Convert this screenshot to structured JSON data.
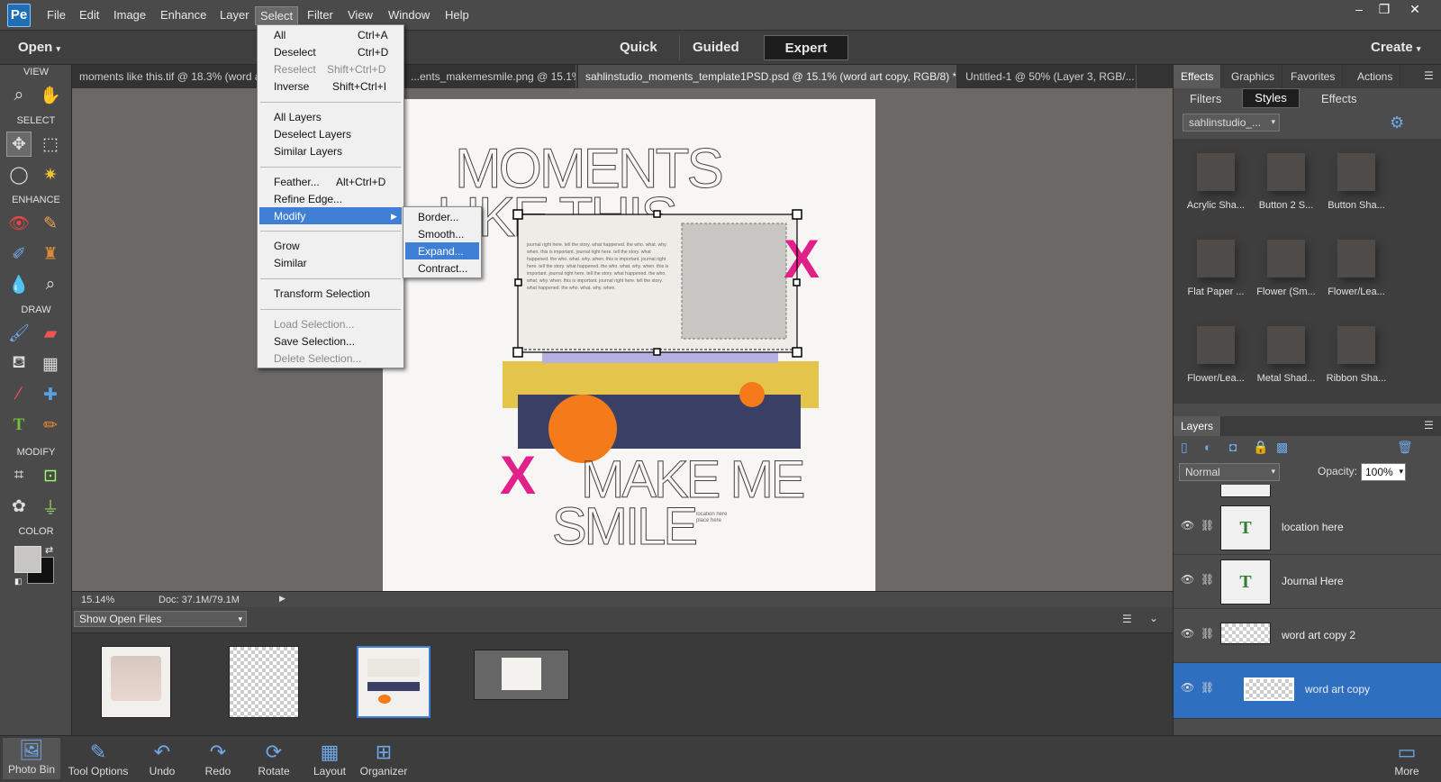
{
  "menubar": {
    "items": [
      "File",
      "Edit",
      "Image",
      "Enhance",
      "Layer",
      "Select",
      "Filter",
      "View",
      "Window",
      "Help"
    ],
    "active": "Select",
    "window_controls": [
      "–",
      "❐",
      "✕"
    ]
  },
  "modebar": {
    "open_label": "Open",
    "modes": [
      "Quick",
      "Guided",
      "Expert"
    ],
    "selected_mode": "Expert",
    "create_label": "Create"
  },
  "toolbox": {
    "sections": [
      "VIEW",
      "SELECT",
      "ENHANCE",
      "DRAW",
      "MODIFY",
      "COLOR"
    ]
  },
  "doc_tabs": [
    {
      "label": "moments like this.tif @ 18.3% (word art..."
    },
    {
      "label": "...ents_makemesmile.png @ 15.1% ..."
    },
    {
      "label": "sahlinstudio_moments_template1PSD.psd @ 15.1% (word art copy, RGB/8) *"
    },
    {
      "label": "Untitled-1 @ 50% (Layer 3, RGB/..."
    }
  ],
  "canvas": {
    "title_line1": "MOMENTS",
    "title_line2": "LIKE THIS",
    "subtitle_line1": "MAKE ME",
    "subtitle_line2": "SMILE",
    "journal_text": "journal right here. tell the story. what happened. the who. what. why. when. this is important. journal right here. tell the story. what happened. the who. what. why. when. this is important. journal right here. tell the story. what happened. the who. what. why. when. this is important. journal right here. tell the story. what happened. the who. what. why. when. this is important. journal right here. tell the story. what happened. the who. what. why. when.",
    "location_text": "location here\nplace here",
    "x_mark": "X"
  },
  "status": {
    "zoom": "15.14%",
    "doc": "Doc: 37.1M/79.1M"
  },
  "bin": {
    "dropdown": "Show Open Files"
  },
  "select_menu": {
    "items": [
      {
        "label": "All",
        "shortcut": "Ctrl+A",
        "disabled": false
      },
      {
        "label": "Deselect",
        "shortcut": "Ctrl+D",
        "disabled": false
      },
      {
        "label": "Reselect",
        "shortcut": "Shift+Ctrl+D",
        "disabled": true
      },
      {
        "label": "Inverse",
        "shortcut": "Shift+Ctrl+I",
        "disabled": false
      },
      {
        "label": "All Layers",
        "shortcut": "",
        "disabled": false
      },
      {
        "label": "Deselect Layers",
        "shortcut": "",
        "disabled": false
      },
      {
        "label": "Similar Layers",
        "shortcut": "",
        "disabled": false
      },
      {
        "label": "Feather...",
        "shortcut": "Alt+Ctrl+D",
        "disabled": false
      },
      {
        "label": "Refine Edge...",
        "shortcut": "",
        "disabled": false
      },
      {
        "label": "Modify",
        "shortcut": "",
        "disabled": false
      },
      {
        "label": "Grow",
        "shortcut": "",
        "disabled": false
      },
      {
        "label": "Similar",
        "shortcut": "",
        "disabled": false
      },
      {
        "label": "Transform Selection",
        "shortcut": "",
        "disabled": false
      },
      {
        "label": "Load Selection...",
        "shortcut": "",
        "disabled": true
      },
      {
        "label": "Save Selection...",
        "shortcut": "",
        "disabled": false
      },
      {
        "label": "Delete Selection...",
        "shortcut": "",
        "disabled": true
      }
    ],
    "highlighted": "Modify"
  },
  "modify_submenu": {
    "items": [
      "Border...",
      "Smooth...",
      "Expand...",
      "Contract..."
    ],
    "highlighted": "Expand..."
  },
  "right_panel": {
    "tabs": [
      "Effects",
      "Graphics",
      "Favorites",
      "Actions"
    ],
    "active_tab": "Effects",
    "subtabs": [
      "Filters",
      "Styles",
      "Effects"
    ],
    "active_subtab": "Styles",
    "library": "sahlinstudio_...",
    "styles": [
      "Acrylic Sha...",
      "Button 2 S...",
      "Button Sha...",
      "Flat Paper ...",
      "Flower (Sm...",
      "Flower/Lea...",
      "Flower/Lea...",
      "Metal Shad...",
      "Ribbon Sha..."
    ]
  },
  "layers": {
    "title": "Layers",
    "blend_mode": "Normal",
    "opacity_label": "Opacity:",
    "opacity_value": "100%",
    "rows": [
      {
        "name": "location here",
        "type": "text",
        "selected": false
      },
      {
        "name": "Journal Here",
        "type": "text",
        "selected": false
      },
      {
        "name": "word art copy 2",
        "type": "pixel",
        "selected": false
      },
      {
        "name": "word art copy",
        "type": "pixel",
        "selected": true
      }
    ]
  },
  "bottombar": {
    "buttons": [
      "Photo Bin",
      "Tool Options",
      "Undo",
      "Redo",
      "Rotate",
      "Layout",
      "Organizer"
    ],
    "more_label": "More"
  },
  "colors": {
    "accent": "#3f7fd6",
    "pink": "#e0218a",
    "orange": "#f47a1a",
    "navy": "#3a3f66",
    "mustard": "#e4c44a",
    "lavender": "#b4b0e0"
  }
}
